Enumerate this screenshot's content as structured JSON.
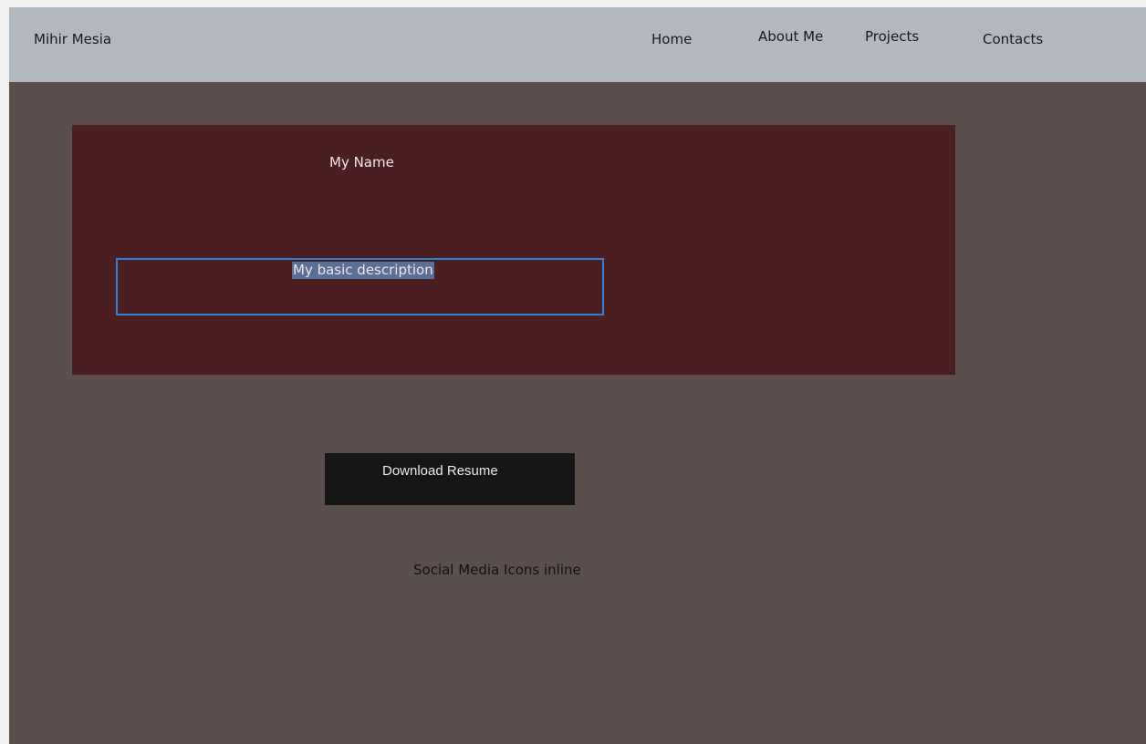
{
  "header": {
    "brand": "Mihir Mesia",
    "nav": {
      "home": "Home",
      "about": "About Me",
      "projects": "Projects",
      "contacts": "Contacts"
    }
  },
  "hero": {
    "name": "My Name",
    "description": "My basic description"
  },
  "actions": {
    "download_resume": "Download Resume"
  },
  "social": {
    "placeholder": "Social Media Icons inline"
  },
  "colors": {
    "navbar_bg": "#b3b8c0",
    "page_bg": "#5b4f4e",
    "hero_bg": "#4b1e22",
    "button_bg": "#161616",
    "selection_border": "#2f7fd2",
    "text_highlight": "#5a6f98"
  }
}
